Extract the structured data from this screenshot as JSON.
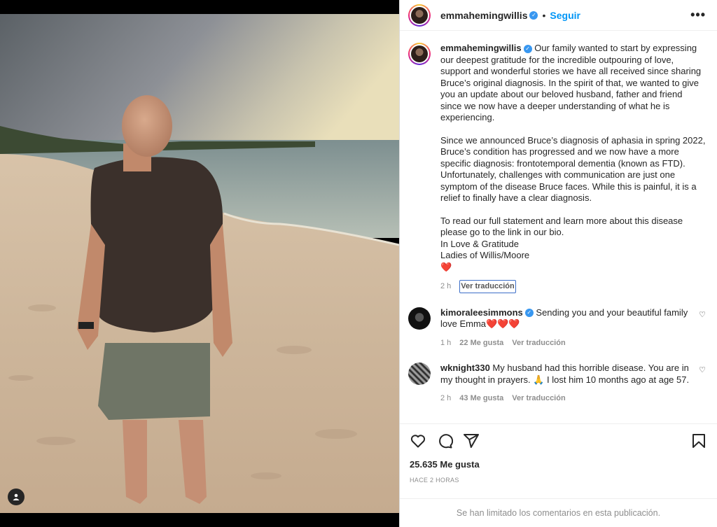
{
  "post": {
    "username": "emmahemingwillis",
    "follow_label": "Seguir",
    "more_label": "•••",
    "dot": "•"
  },
  "caption": {
    "username": "emmahemingwillis",
    "paragraphs": [
      "Our family wanted to start by expressing our deepest gratitude for the incredible outpouring of love, support and wonderful stories we have all received since sharing Bruce’s original diagnosis. In the spirit of that, we wanted to give you an update about our beloved husband, father and friend since we now have a deeper understanding of what he is experiencing.",
      "Since we announced Bruce’s diagnosis of aphasia in spring 2022, Bruce’s condition has progressed and we now have a more specific diagnosis: frontotemporal dementia (known as FTD). Unfortunately, challenges with communication are just one symptom of the disease Bruce faces. While this is painful, it is a relief to finally have a clear diagnosis."
    ],
    "closing_lines": [
      "To read our full statement and learn more about this disease please go to the link in our bio.",
      "In Love & Gratitude",
      "Ladies of Willis/Moore",
      "❤️"
    ],
    "time": "2 h",
    "translate_label": "Ver traducción"
  },
  "comments": [
    {
      "username": "kimoraleesimmons",
      "text": "Sending you and your beautiful family love Emma❤️❤️❤️",
      "time": "1 h",
      "likes": "22 Me gusta",
      "translate_label": "Ver traducción"
    },
    {
      "username": "wknight330",
      "text": "My husband had this horrible disease. You are in my thought in prayers. 🙏 I lost him 10 months ago at age 57.",
      "time": "2 h",
      "likes": "43 Me gusta",
      "translate_label": "Ver traducción"
    }
  ],
  "stats": {
    "likes": "25.635 Me gusta",
    "time_ago": "HACE 2 HORAS"
  },
  "footer": {
    "limited_text": "Se han limitado los comentarios en esta publicación."
  },
  "colors": {
    "accent": "#0095f6",
    "verified": "#3897f0",
    "muted": "#8e8e8e"
  },
  "icons": [
    "heart-icon",
    "comment-icon",
    "share-icon",
    "bookmark-icon",
    "user-tag-icon",
    "verified-icon",
    "more-options-icon"
  ]
}
